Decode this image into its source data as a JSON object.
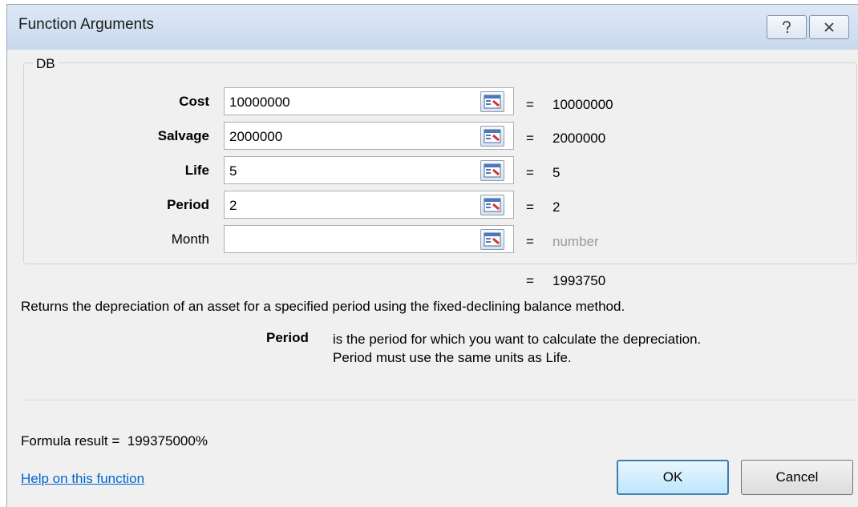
{
  "window": {
    "title": "Function Arguments"
  },
  "function_name": "DB",
  "arguments": [
    {
      "label": "Cost",
      "bold": true,
      "value": "10000000",
      "result": "10000000",
      "muted": false
    },
    {
      "label": "Salvage",
      "bold": true,
      "value": "2000000",
      "result": "2000000",
      "muted": false
    },
    {
      "label": "Life",
      "bold": true,
      "value": "5",
      "result": "5",
      "muted": false
    },
    {
      "label": "Period",
      "bold": true,
      "value": "2",
      "result": "2",
      "muted": false
    },
    {
      "label": "Month",
      "bold": false,
      "value": "",
      "result": "number",
      "muted": true
    }
  ],
  "equals_sign": "=",
  "overall_result": "1993750",
  "description": "Returns the depreciation of an asset for a specified period using the fixed-declining balance method.",
  "argument_help": {
    "name": "Period",
    "line1": "is the period for which you want to calculate the depreciation.",
    "line2": "Period must use the same units as Life."
  },
  "formula_result": {
    "label": "Formula result =",
    "value": "199375000%"
  },
  "help_link": "Help on this function",
  "buttons": {
    "ok": "OK",
    "cancel": "Cancel"
  },
  "colors": {
    "link": "#0066cc",
    "muted": "#9a9a9a",
    "titlebar": "#c9d9ee"
  },
  "icons": [
    "help-icon",
    "close-icon",
    "collapse-dialog-icon"
  ]
}
